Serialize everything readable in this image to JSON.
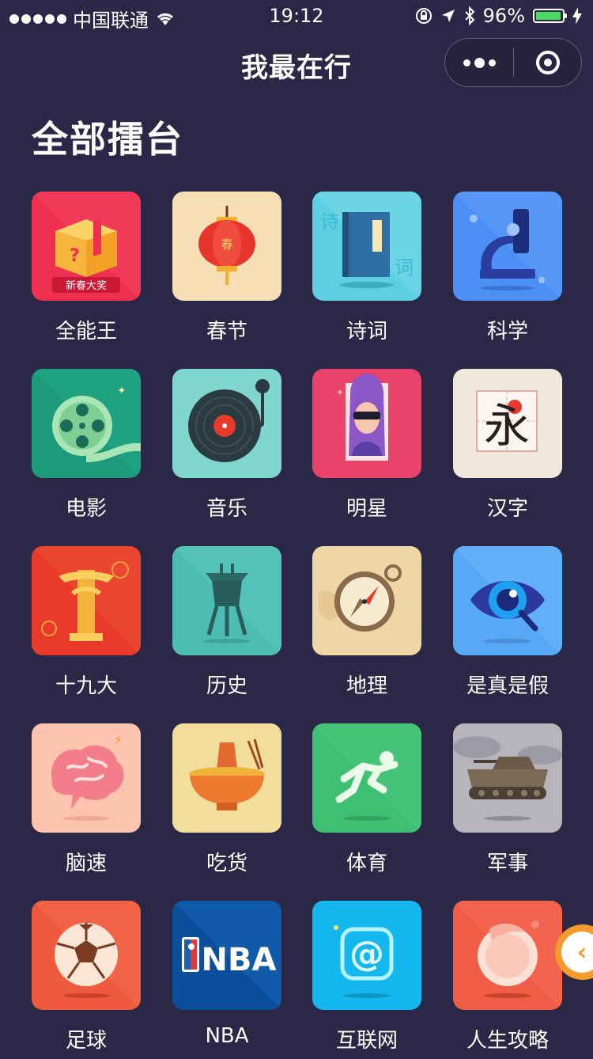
{
  "status": {
    "carrier": "中国联通",
    "time": "19:12",
    "battery": "96%",
    "battery_level": 0.96
  },
  "nav": {
    "title": "我最在行"
  },
  "section_title": "全部擂台",
  "categories": [
    {
      "label": "全能王",
      "icon": "gift-box-icon",
      "icon_text": "新春大奖",
      "bg": "#ef2f4f"
    },
    {
      "label": "春节",
      "icon": "lantern-icon",
      "icon_text": "春",
      "bg": "#f6dfb4"
    },
    {
      "label": "诗词",
      "icon": "book-icon",
      "icon_text": "诗词",
      "bg": "#5ccfe2"
    },
    {
      "label": "科学",
      "icon": "microscope-icon",
      "bg": "#4c8ff5"
    },
    {
      "label": "电影",
      "icon": "film-reel-icon",
      "bg": "#1d9a7c"
    },
    {
      "label": "音乐",
      "icon": "vinyl-record-icon",
      "bg": "#7fd6cf"
    },
    {
      "label": "明星",
      "icon": "star-celebrity-icon",
      "bg": "#e9436a"
    },
    {
      "label": "汉字",
      "icon": "chinese-character-icon",
      "icon_text": "永",
      "bg": "#f1e8dc"
    },
    {
      "label": "十九大",
      "icon": "huabiao-pillar-icon",
      "bg": "#e8392b"
    },
    {
      "label": "历史",
      "icon": "bronze-vessel-icon",
      "bg": "#4dbcb3"
    },
    {
      "label": "地理",
      "icon": "compass-icon",
      "bg": "#efd6a6"
    },
    {
      "label": "是真是假",
      "icon": "eye-icon",
      "bg": "#57a8f5"
    },
    {
      "label": "脑速",
      "icon": "brain-icon",
      "bg": "#fcc3ae"
    },
    {
      "label": "吃货",
      "icon": "hotpot-icon",
      "bg": "#f2dd9c"
    },
    {
      "label": "体育",
      "icon": "runner-icon",
      "bg": "#3fbf72"
    },
    {
      "label": "军事",
      "icon": "tank-icon",
      "bg": "#b7b5bb"
    },
    {
      "label": "足球",
      "icon": "soccer-ball-icon",
      "bg": "#ef5a3e"
    },
    {
      "label": "NBA",
      "icon": "nba-logo-icon",
      "icon_text": "NBA",
      "bg": "#0b4f9c"
    },
    {
      "label": "互联网",
      "icon": "at-sign-icon",
      "icon_text": "@",
      "bg": "#14b8ef"
    },
    {
      "label": "人生攻略",
      "icon": "peach-icon",
      "bg": "#f05c45"
    }
  ],
  "side_tab": {
    "icon": "chevron-left-icon",
    "glyph": "‹"
  }
}
